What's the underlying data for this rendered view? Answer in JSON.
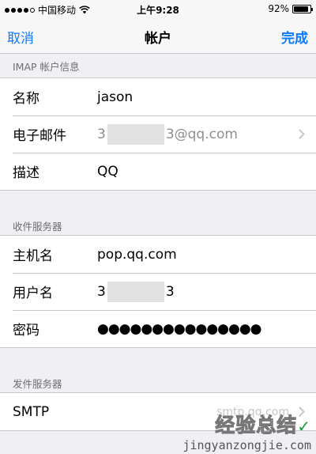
{
  "status_bar": {
    "carrier": "中国移动",
    "time": "上午9:28",
    "battery_percent": "92%",
    "battery_level": 0.92,
    "signal_filled": 4,
    "signal_total": 5
  },
  "nav": {
    "cancel_label": "取消",
    "title": "帐户",
    "done_label": "完成",
    "accent_color": "#0a7aff"
  },
  "imap_section": {
    "header": "IMAP 帐户信息",
    "rows": [
      {
        "label": "名称",
        "value": "jason"
      },
      {
        "label": "电子邮件",
        "value_prefix": "3",
        "value_suffix": "3@qq.com"
      },
      {
        "label": "描述",
        "value": "QQ"
      }
    ]
  },
  "incoming_section": {
    "header": "收件服务器",
    "rows": [
      {
        "label": "主机名",
        "value": "pop.qq.com"
      },
      {
        "label": "用户名",
        "value_prefix": "3",
        "value_suffix": "3"
      },
      {
        "label": "密码",
        "value": "●●●●●●●●●●●●●●●"
      }
    ]
  },
  "outgoing_section": {
    "header": "发件服务器",
    "rows": [
      {
        "label": "SMTP",
        "value": "smtp.qq.com"
      }
    ]
  },
  "watermark": {
    "text_cn": "经验总结",
    "url": "jingyanzongjie.com"
  }
}
